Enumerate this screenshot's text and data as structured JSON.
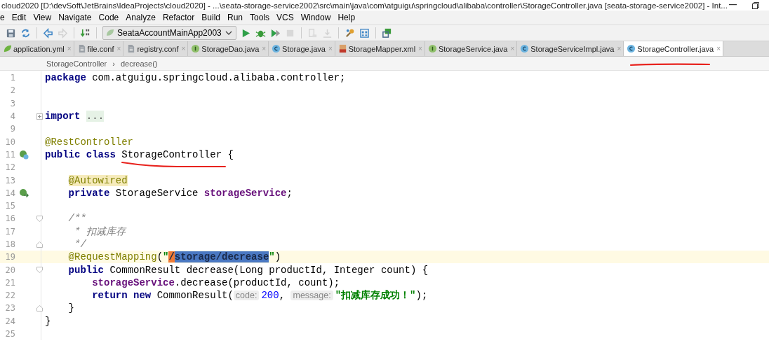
{
  "window": {
    "title": "cloud2020 [D:\\devSoft\\JetBrains\\IdeaProjects\\cloud2020] - ...\\seata-storage-service2002\\src\\main\\java\\com\\atguigu\\springcloud\\alibaba\\controller\\StorageController.java [seata-storage-service2002] - Int..."
  },
  "menu": [
    "e",
    "Edit",
    "View",
    "Navigate",
    "Code",
    "Analyze",
    "Refactor",
    "Build",
    "Run",
    "Tools",
    "VCS",
    "Window",
    "Help"
  ],
  "toolbar": [
    {
      "kind": "save",
      "disabled": false
    },
    {
      "kind": "sync",
      "disabled": false
    },
    {
      "kind": "back",
      "disabled": false
    },
    {
      "kind": "forward",
      "disabled": true
    },
    {
      "kind": "build",
      "disabled": false
    },
    {
      "kind": "run_config",
      "label": "SeataAccountMainApp2003"
    },
    {
      "kind": "run",
      "disabled": false
    },
    {
      "kind": "debug",
      "disabled": false
    },
    {
      "kind": "coverage",
      "disabled": false
    },
    {
      "kind": "stop",
      "disabled": true
    },
    {
      "kind": "attach",
      "disabled": true
    },
    {
      "kind": "deploy",
      "disabled": true
    },
    {
      "kind": "wrench",
      "disabled": false
    },
    {
      "kind": "structure",
      "disabled": false
    },
    {
      "kind": "sdk",
      "disabled": false
    }
  ],
  "tabs": [
    {
      "label": "application.yml",
      "kind": "yml",
      "close": "×",
      "selected": false
    },
    {
      "label": "file.conf",
      "kind": "conf",
      "close": "×",
      "selected": false
    },
    {
      "label": "registry.conf",
      "kind": "conf",
      "close": "×",
      "selected": false
    },
    {
      "label": "StorageDao.java",
      "kind": "interface",
      "close": "×",
      "selected": false
    },
    {
      "label": "Storage.java",
      "kind": "class",
      "close": "×",
      "selected": false
    },
    {
      "label": "StorageMapper.xml",
      "kind": "xml",
      "close": "×",
      "selected": false
    },
    {
      "label": "StorageService.java",
      "kind": "interface",
      "close": "×",
      "selected": false
    },
    {
      "label": "StorageServiceImpl.java",
      "kind": "class",
      "close": "×",
      "selected": false
    },
    {
      "label": "StorageController.java",
      "kind": "class",
      "close": "×",
      "selected": true,
      "underlined": true
    }
  ],
  "breadcrumb": [
    "StorageController",
    "›",
    "decrease()"
  ],
  "lines": [
    {
      "number": "1",
      "tokens": [
        {
          "kind": "keyword",
          "text": "package"
        },
        {
          "kind": "plain",
          "text": " com.atguigu.springcloud.alibaba.controller;"
        }
      ]
    },
    {
      "number": "2"
    },
    {
      "number": "3"
    },
    {
      "number": "4",
      "fold": {
        "kind": "collapsed"
      },
      "tokens": [
        {
          "kind": "keyword",
          "text": "import"
        },
        {
          "kind": "folded",
          "text": " ..."
        }
      ]
    },
    {
      "number": "9"
    },
    {
      "number": "10",
      "tokens": [
        {
          "kind": "annotation",
          "text": "@RestController"
        }
      ]
    },
    {
      "number": "11",
      "gutter": {
        "kind": "bean_class"
      },
      "tokens": [
        {
          "kind": "keyword",
          "text": "public class "
        },
        {
          "kind": "plain",
          "text": "StorageController",
          "underlined": true
        },
        {
          "kind": "plain",
          "text": " {"
        }
      ]
    },
    {
      "number": "12"
    },
    {
      "number": "13",
      "tokens": [
        {
          "kind": "annotation_marked",
          "text": "    @Autowired"
        }
      ]
    },
    {
      "number": "14",
      "gutter": {
        "kind": "bean_link"
      },
      "tokens": [
        {
          "kind": "keyword",
          "text": "    private"
        },
        {
          "kind": "plain",
          "text": " StorageService "
        },
        {
          "kind": "field",
          "text": "storageService"
        },
        {
          "kind": "plain",
          "text": ";"
        }
      ]
    },
    {
      "number": "15"
    },
    {
      "number": "16",
      "fold": {
        "kind": "start"
      },
      "tokens": [
        {
          "kind": "comment",
          "text": "    /**"
        }
      ]
    },
    {
      "number": "17",
      "tokens": [
        {
          "kind": "comment",
          "text": "     * 扣减库存"
        }
      ]
    },
    {
      "number": "18",
      "fold": {
        "kind": "end"
      },
      "tokens": [
        {
          "kind": "comment",
          "text": "     */"
        }
      ]
    },
    {
      "number": "19",
      "current": true,
      "tokens": [
        {
          "kind": "annotation",
          "text": "    @RequestMapping"
        },
        {
          "kind": "plain",
          "text": "("
        },
        {
          "kind": "string",
          "text": "\""
        },
        {
          "kind": "string_caret",
          "text": "/"
        },
        {
          "kind": "string_selected",
          "text": "storage/decrease"
        },
        {
          "kind": "string",
          "text": "\""
        },
        {
          "kind": "plain",
          "text": ")"
        }
      ]
    },
    {
      "number": "20",
      "fold": {
        "kind": "start"
      },
      "tokens": [
        {
          "kind": "keyword",
          "text": "    public"
        },
        {
          "kind": "plain",
          "text": " CommonResult decrease(Long productId, Integer count) {"
        }
      ]
    },
    {
      "number": "21",
      "tokens": [
        {
          "kind": "field",
          "text": "        storageService"
        },
        {
          "kind": "plain",
          "text": ".decrease(productId, count);"
        }
      ]
    },
    {
      "number": "22",
      "tokens": [
        {
          "kind": "keyword",
          "text": "        return new"
        },
        {
          "kind": "plain",
          "text": " CommonResult("
        },
        {
          "kind": "hint",
          "text": "code:"
        },
        {
          "kind": "number",
          "text": "200"
        },
        {
          "kind": "plain",
          "text": ", "
        },
        {
          "kind": "hint",
          "text": "message:"
        },
        {
          "kind": "string",
          "text": "\"扣减库存成功！\""
        },
        {
          "kind": "plain",
          "text": ");"
        }
      ]
    },
    {
      "number": "23",
      "fold": {
        "kind": "end"
      },
      "tokens": [
        {
          "kind": "plain",
          "text": "    }"
        }
      ]
    },
    {
      "number": "24",
      "tokens": [
        {
          "kind": "plain",
          "text": "}"
        }
      ]
    },
    {
      "number": "25"
    }
  ]
}
